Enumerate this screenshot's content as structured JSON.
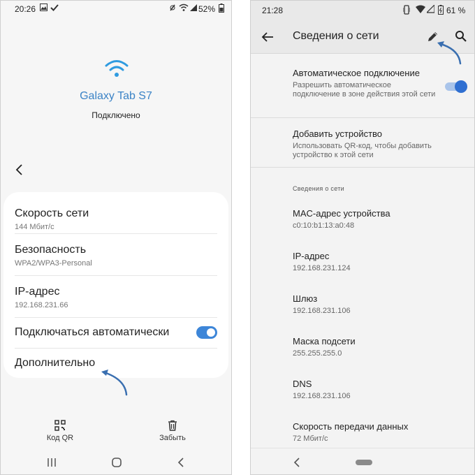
{
  "left_phone": {
    "status": {
      "time": "20:26",
      "battery": "52%"
    },
    "network_name": "Galaxy Tab S7",
    "network_status": "Подключено",
    "rows": [
      {
        "title": "Скорость сети",
        "value": "144 Мбит/с"
      },
      {
        "title": "Безопасность",
        "value": "WPA2/WPA3-Personal"
      },
      {
        "title": "IP-адрес",
        "value": "192.168.231.66"
      }
    ],
    "auto_connect": {
      "label": "Подключаться автоматически",
      "enabled": true
    },
    "advanced_label": "Дополнительно",
    "actions": [
      {
        "label": "Код QR",
        "icon": "qr-code-icon"
      },
      {
        "label": "Забыть",
        "icon": "trash-icon"
      }
    ]
  },
  "right_phone": {
    "status": {
      "time": "21:28",
      "battery": "61 %"
    },
    "title": "Сведения о сети",
    "auto_connect": {
      "title": "Автоматическое подключение",
      "subtitle": "Разрешить автоматическое подключение в зоне действия этой сети",
      "enabled": true
    },
    "add_device": {
      "title": "Добавить устройство",
      "subtitle": "Использовать QR-код, чтобы добавить устройство к этой сети"
    },
    "section_header": "Сведения о сети",
    "details": [
      {
        "title": "MAC-адрес устройства",
        "value": "c0:10:b1:13:a0:48"
      },
      {
        "title": "IP-адрес",
        "value": "192.168.231.124"
      },
      {
        "title": "Шлюз",
        "value": "192.168.231.106"
      },
      {
        "title": "Маска подсети",
        "value": "255.255.255.0"
      },
      {
        "title": "DNS",
        "value": "192.168.231.106"
      },
      {
        "title": "Скорость передачи данных",
        "value": "72 Мбит/с"
      }
    ]
  },
  "colors": {
    "accent_blue": "#3b83c6",
    "toggle_blue": "#3d86d8",
    "annotation_arrow": "#3a6fb0"
  }
}
